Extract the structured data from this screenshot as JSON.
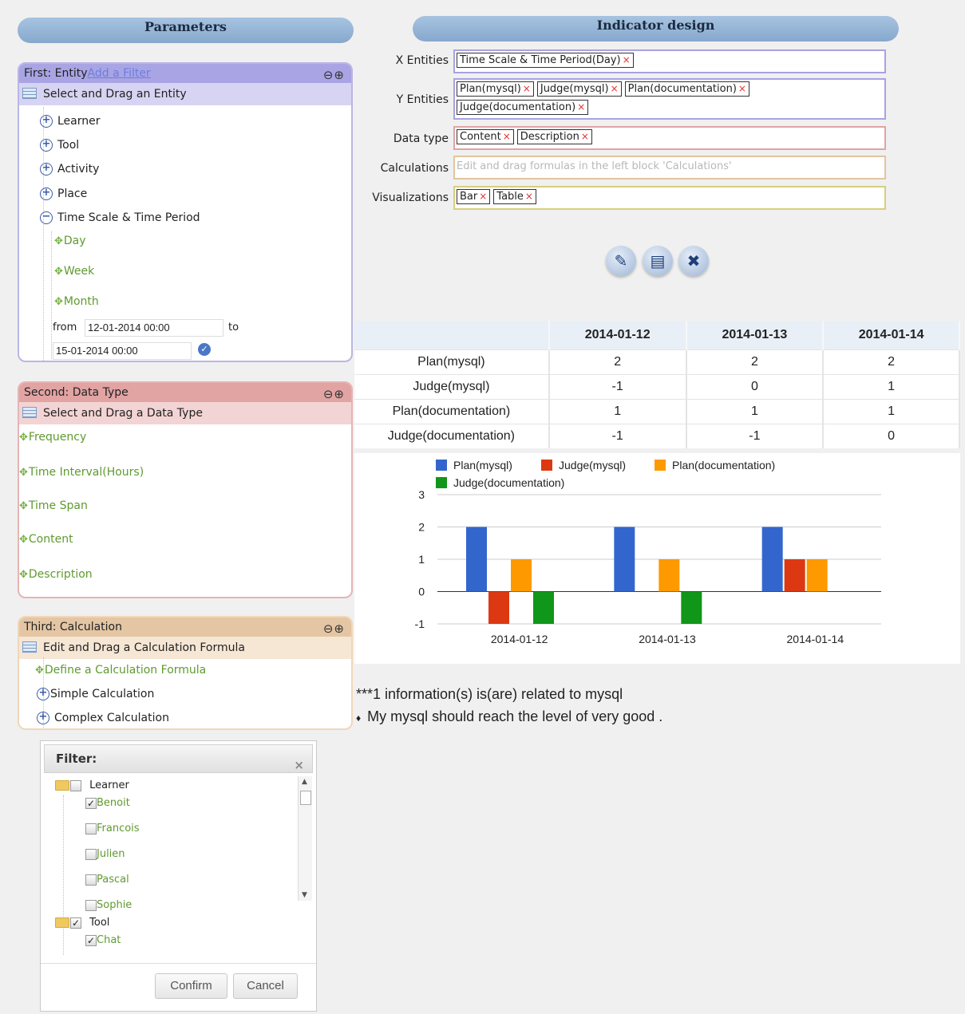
{
  "headers": {
    "parameters": "Parameters",
    "indicator_design": "Indicator design"
  },
  "first": {
    "title": "First: Entity",
    "add_filter": "Add a Filter",
    "subtitle": "Select and Drag an Entity",
    "entities": [
      "Learner",
      "Tool",
      "Activity",
      "Place"
    ],
    "time_node": "Time Scale & Time Period",
    "time_children": [
      "Day",
      "Week",
      "Month"
    ],
    "from_label": "from",
    "to_label": "to",
    "from_value": "12-01-2014 00:00",
    "to_value": "15-01-2014 00:00"
  },
  "second": {
    "title": "Second: Data Type",
    "subtitle": "Select and Drag a Data Type",
    "items": [
      "Frequency",
      "Time Interval(Hours)",
      "Time Span",
      "Content",
      "Description"
    ]
  },
  "third": {
    "title": "Third: Calculation",
    "subtitle": "Edit and Drag a Calculation Formula",
    "define": "Define a Calculation Formula",
    "simple": "Simple Calculation",
    "complex": "Complex Calculation"
  },
  "design": {
    "x_label": "X Entities",
    "x_tags": [
      "Time Scale & Time Period(Day)"
    ],
    "y_label": "Y Entities",
    "y_tags": [
      "Plan(mysql)",
      "Judge(mysql)",
      "Plan(documentation)",
      "Judge(documentation)"
    ],
    "dtype_label": "Data type",
    "dtype_tags": [
      "Content",
      "Description"
    ],
    "calc_label": "Calculations",
    "calc_placeholder": "Edit and drag formulas in the left block 'Calculations'",
    "vis_label": "Visualizations",
    "vis_tags": [
      "Bar",
      "Table"
    ],
    "tag_remove": "×"
  },
  "actions": {
    "edit_icon": "pencil-icon",
    "save_icon": "document-add-icon",
    "delete_icon": "close-icon"
  },
  "table": {
    "columns": [
      "",
      "2014-01-12",
      "2014-01-13",
      "2014-01-14"
    ],
    "rows": [
      [
        "Plan(mysql)",
        "2",
        "2",
        "2"
      ],
      [
        "Judge(mysql)",
        "-1",
        "0",
        "1"
      ],
      [
        "Plan(documentation)",
        "1",
        "1",
        "1"
      ],
      [
        "Judge(documentation)",
        "-1",
        "-1",
        "0"
      ]
    ]
  },
  "chart_data": {
    "type": "bar",
    "categories": [
      "2014-01-12",
      "2014-01-13",
      "2014-01-14"
    ],
    "series": [
      {
        "name": "Plan(mysql)",
        "values": [
          2,
          2,
          2
        ],
        "color": "#3366cc"
      },
      {
        "name": "Judge(mysql)",
        "values": [
          -1,
          0,
          1
        ],
        "color": "#dc3912"
      },
      {
        "name": "Plan(documentation)",
        "values": [
          1,
          1,
          1
        ],
        "color": "#ff9900"
      },
      {
        "name": "Judge(documentation)",
        "values": [
          -1,
          -1,
          0
        ],
        "color": "#109618"
      }
    ],
    "yticks": [
      3,
      2,
      1,
      0,
      -1
    ],
    "ylim": [
      -1,
      3
    ],
    "legend_position": "top",
    "grid": true
  },
  "info": {
    "line1": "***1 information(s) is(are) related to mysql",
    "bullet": "♦",
    "line2": "My mysql should reach the level of very good ."
  },
  "filter": {
    "title": "Filter:",
    "close": "×",
    "groups": [
      {
        "label": "Learner",
        "checked": false,
        "children": [
          {
            "label": "Benoit",
            "checked": true
          },
          {
            "label": "Francois",
            "checked": false
          },
          {
            "label": "Julien",
            "checked": false
          },
          {
            "label": "Pascal",
            "checked": false
          },
          {
            "label": "Sophie",
            "checked": false
          }
        ]
      },
      {
        "label": "Tool",
        "checked": true,
        "children": [
          {
            "label": "Chat",
            "checked": true
          }
        ]
      }
    ],
    "confirm": "Confirm",
    "cancel": "Cancel"
  }
}
